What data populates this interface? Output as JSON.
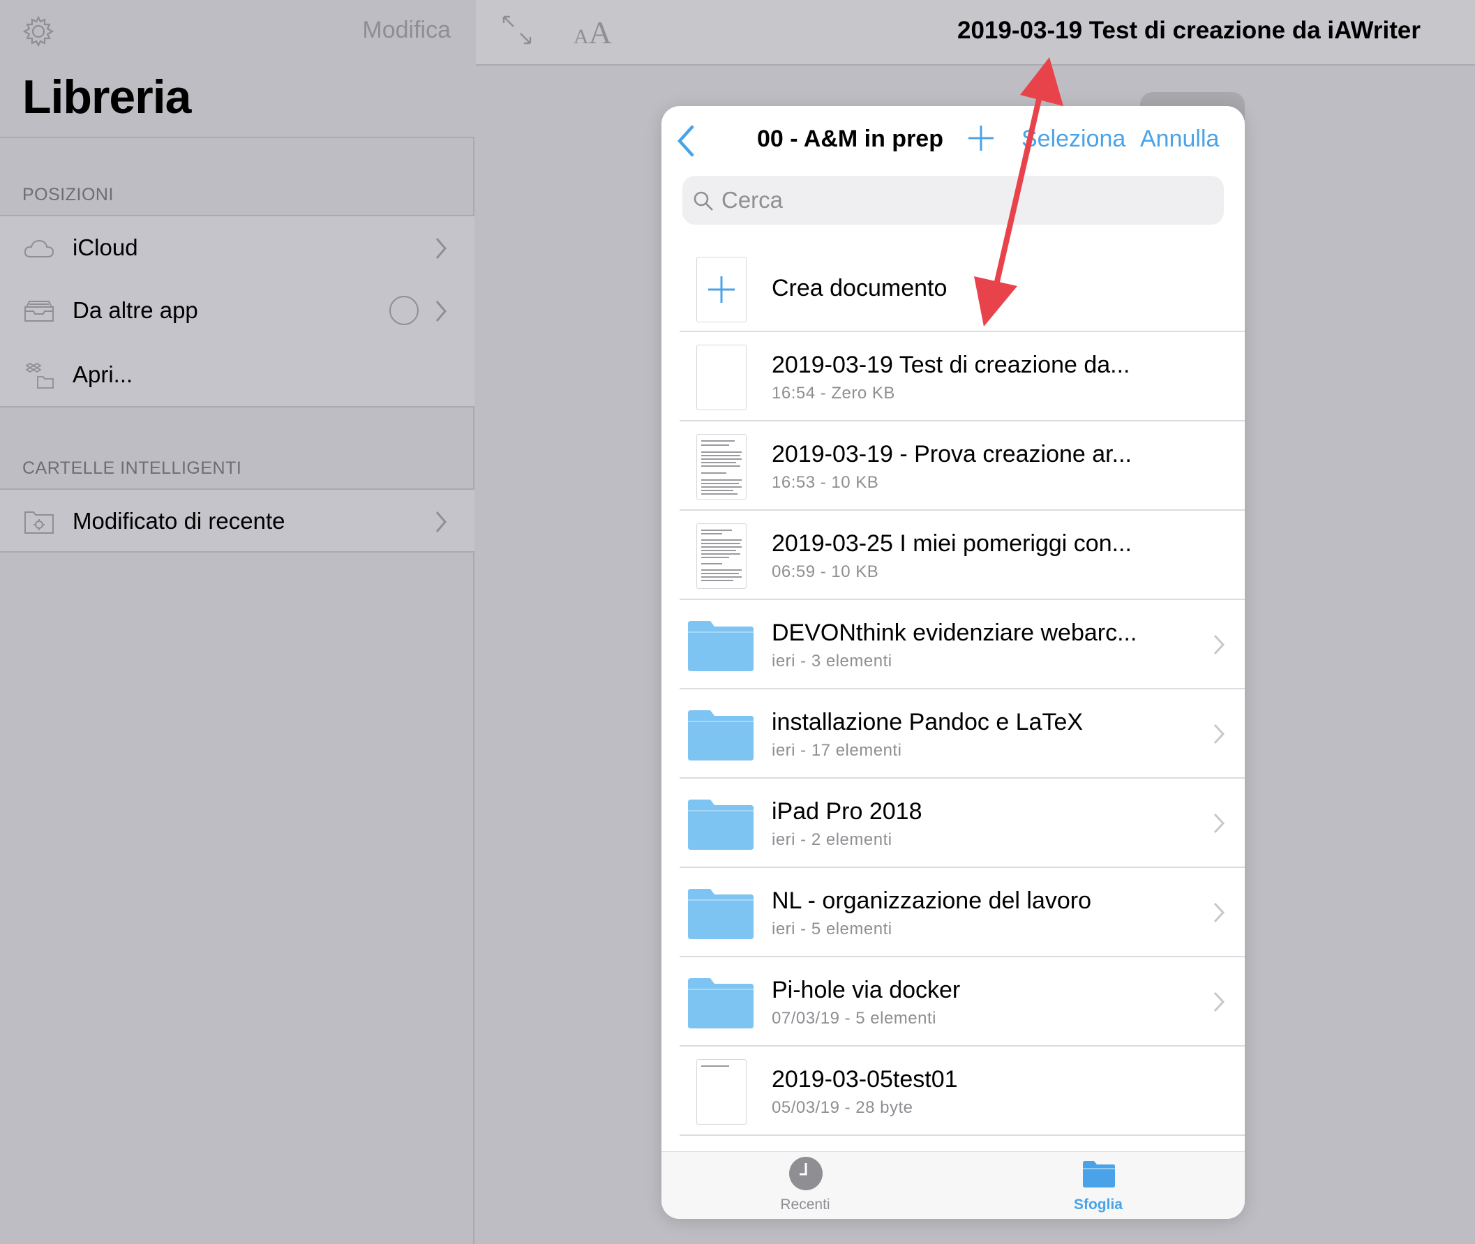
{
  "sidebar": {
    "edit_label": "Modifica",
    "title": "Libreria",
    "section_locations": "POSIZIONI",
    "locations": [
      {
        "label": "iCloud",
        "icon": "cloud-icon"
      },
      {
        "label": "Da altre app",
        "icon": "tray-icon"
      },
      {
        "label": "Apri...",
        "icon": "dropbox-folder-icon"
      }
    ],
    "section_smart": "CARTELLE INTELLIGENTI",
    "smart_folders": [
      {
        "label": "Modificato di recente",
        "icon": "smart-folder-icon"
      }
    ]
  },
  "editor": {
    "document_title": "2019-03-19 Test di creazione da iAWriter",
    "font_icon_small": "A",
    "font_icon_large": "A"
  },
  "picker": {
    "folder_title": "00 - A&M in prep",
    "select_label": "Seleziona",
    "cancel_label": "Annulla",
    "search_placeholder": "Cerca",
    "create_label": "Crea documento",
    "items": [
      {
        "name": "2019-03-19 Test di creazione da...",
        "meta": "16:54 - Zero KB",
        "kind": "file"
      },
      {
        "name": "2019-03-19 - Prova creazione ar...",
        "meta": "16:53 - 10 KB",
        "kind": "file"
      },
      {
        "name": "2019-03-25 I miei pomeriggi con...",
        "meta": "06:59 - 10 KB",
        "kind": "file"
      },
      {
        "name": "DEVONthink evidenziare webarc...",
        "meta": "ieri - 3 elementi",
        "kind": "folder"
      },
      {
        "name": "installazione Pandoc e LaTeX",
        "meta": "ieri - 17 elementi",
        "kind": "folder"
      },
      {
        "name": "iPad Pro 2018",
        "meta": "ieri - 2 elementi",
        "kind": "folder"
      },
      {
        "name": "NL - organizzazione del lavoro",
        "meta": "ieri - 5 elementi",
        "kind": "folder"
      },
      {
        "name": "Pi-hole via docker",
        "meta": "07/03/19 - 5 elementi",
        "kind": "folder"
      },
      {
        "name": "2019-03-05test01",
        "meta": "05/03/19 - 28 byte",
        "kind": "file"
      }
    ],
    "tabs": {
      "recent": "Recenti",
      "browse": "Sfoglia"
    }
  },
  "colors": {
    "accent": "#4aa3e8",
    "folder": "#7dc4f2",
    "annotation_arrow": "#e8434a",
    "sidebar_bg": "#bdbdc3"
  }
}
